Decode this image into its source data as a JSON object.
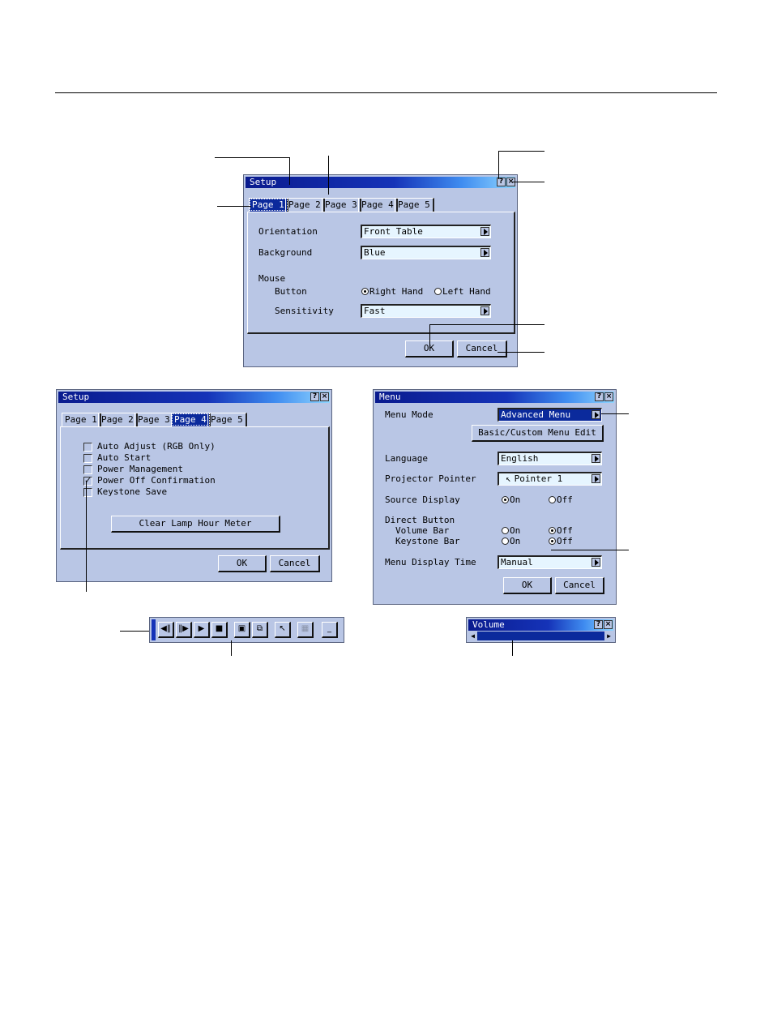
{
  "setup1": {
    "title": "Setup",
    "help": "?",
    "close": "×",
    "tabs": [
      "Page 1",
      "Page 2",
      "Page 3",
      "Page 4",
      "Page 5"
    ],
    "orientation_label": "Orientation",
    "orientation_value": "Front Table",
    "background_label": "Background",
    "background_value": "Blue",
    "mouse_label": "Mouse",
    "button_label": "Button",
    "right_hand": "Right Hand",
    "left_hand": "Left Hand",
    "sensitivity_label": "Sensitivity",
    "sensitivity_value": "Fast",
    "ok": "OK",
    "cancel": "Cancel"
  },
  "setup4": {
    "title": "Setup",
    "help": "?",
    "close": "×",
    "tabs": [
      "Page 1",
      "Page 2",
      "Page 3",
      "Page 4",
      "Page 5"
    ],
    "checks": [
      "Auto Adjust (RGB Only)",
      "Auto Start",
      "Power Management",
      "Power Off Confirmation",
      "Keystone Save"
    ],
    "clear_lamp": "Clear Lamp Hour Meter",
    "ok": "OK",
    "cancel": "Cancel"
  },
  "menu": {
    "title": "Menu",
    "help": "?",
    "close": "×",
    "menu_mode_label": "Menu Mode",
    "menu_mode_value": "Advanced Menu",
    "basic_custom": "Basic/Custom Menu Edit",
    "language_label": "Language",
    "language_value": "English",
    "pointer_label": "Projector Pointer",
    "pointer_value": "Pointer 1",
    "source_label": "Source Display",
    "on": "On",
    "off": "Off",
    "direct_label": "Direct Button",
    "volume_label": "Volume Bar",
    "keystone_label": "Keystone Bar",
    "display_time_label": "Menu Display Time",
    "display_time_value": "Manual",
    "ok": "OK",
    "cancel": "Cancel"
  },
  "volume": {
    "title": "Volume",
    "help": "?",
    "close": "×"
  },
  "toolbar": {
    "minimize": "_"
  }
}
